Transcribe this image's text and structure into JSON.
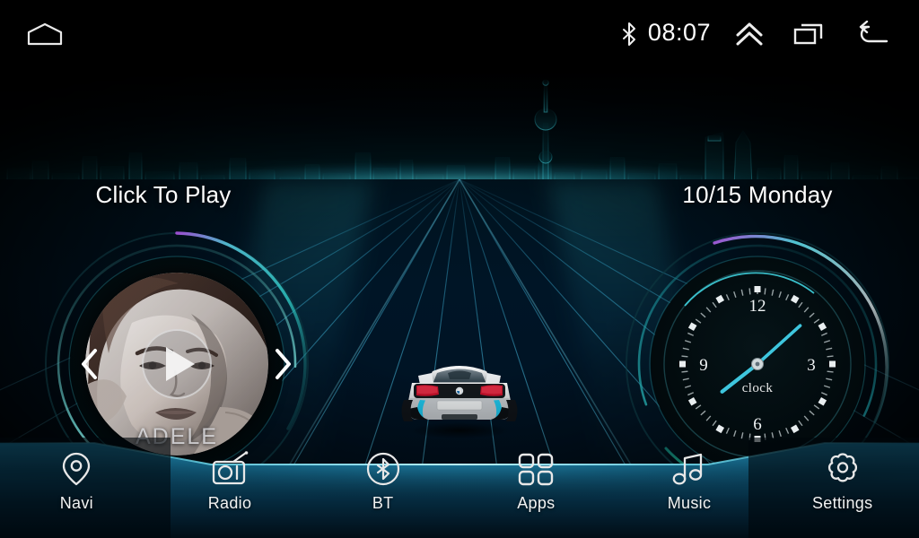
{
  "statusbar": {
    "home_icon": "home-outline-icon",
    "bluetooth_icon": "bluetooth-icon",
    "time": "08:07",
    "up_icon": "double-chevron-up-icon",
    "recent_icon": "recent-apps-icon",
    "back_icon": "back-arrow-icon"
  },
  "media_widget": {
    "title": "Click To Play",
    "album_artist": "ADELE",
    "prev_icon": "chevron-left-icon",
    "next_icon": "chevron-right-icon",
    "play_icon": "play-icon"
  },
  "clock_widget": {
    "date": "10/15  Monday",
    "label": "clock",
    "numerals": [
      "12",
      "3",
      "6",
      "9"
    ],
    "hour_hand_deg": 232,
    "minute_hand_deg": 48
  },
  "dock": {
    "items": [
      {
        "label": "Navi",
        "icon": "map-pin-icon"
      },
      {
        "label": "Radio",
        "icon": "radio-icon"
      },
      {
        "label": "BT",
        "icon": "bluetooth-circle-icon"
      },
      {
        "label": "Apps",
        "icon": "grid-apps-icon"
      },
      {
        "label": "Music",
        "icon": "music-note-icon"
      },
      {
        "label": "Settings",
        "icon": "gear-icon"
      }
    ]
  },
  "scene": {
    "vehicle": "bmw-i8-rear-view",
    "background": "shanghai-skyline-wireframe",
    "ground": "perspective-grid"
  },
  "colors": {
    "accent_teal": "#48d7d2",
    "accent_cyan": "#2ec8e6",
    "accent_purple": "#a04fd0",
    "accent_green": "#2fd07e",
    "dock_glow": "#2a9fc8",
    "text": "#ffffff"
  }
}
